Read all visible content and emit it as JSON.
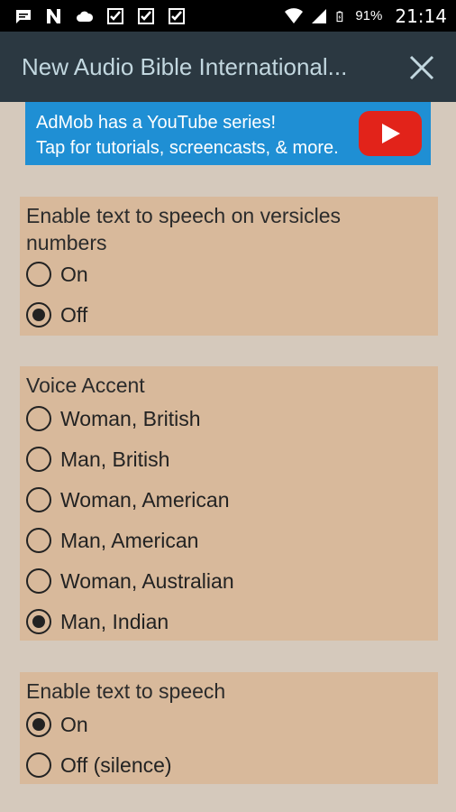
{
  "status_bar": {
    "battery_percent": "91%",
    "time": "21:14"
  },
  "app_bar": {
    "title": "New Audio Bible International..."
  },
  "ad_banner": {
    "line1": "AdMob has a YouTube series!",
    "line2": "Tap for tutorials, screencasts, & more."
  },
  "sections": [
    {
      "title": "Enable text to speech on versicles numbers",
      "options": [
        {
          "label": "On",
          "selected": false
        },
        {
          "label": "Off",
          "selected": true
        }
      ]
    },
    {
      "title": "Voice Accent",
      "options": [
        {
          "label": "Woman, British",
          "selected": false
        },
        {
          "label": "Man, British",
          "selected": false
        },
        {
          "label": "Woman, American",
          "selected": false
        },
        {
          "label": "Man, American",
          "selected": false
        },
        {
          "label": "Woman, Australian",
          "selected": false
        },
        {
          "label": "Man, Indian",
          "selected": true
        }
      ]
    },
    {
      "title": "Enable text to speech",
      "options": [
        {
          "label": "On",
          "selected": true
        },
        {
          "label": "Off (silence)",
          "selected": false
        }
      ]
    }
  ],
  "colors": {
    "card_bg": "#d8b99b",
    "page_bg": "#d5c9bc",
    "app_bar_bg": "#2b3841",
    "ad_bg": "#1f8fd4"
  }
}
